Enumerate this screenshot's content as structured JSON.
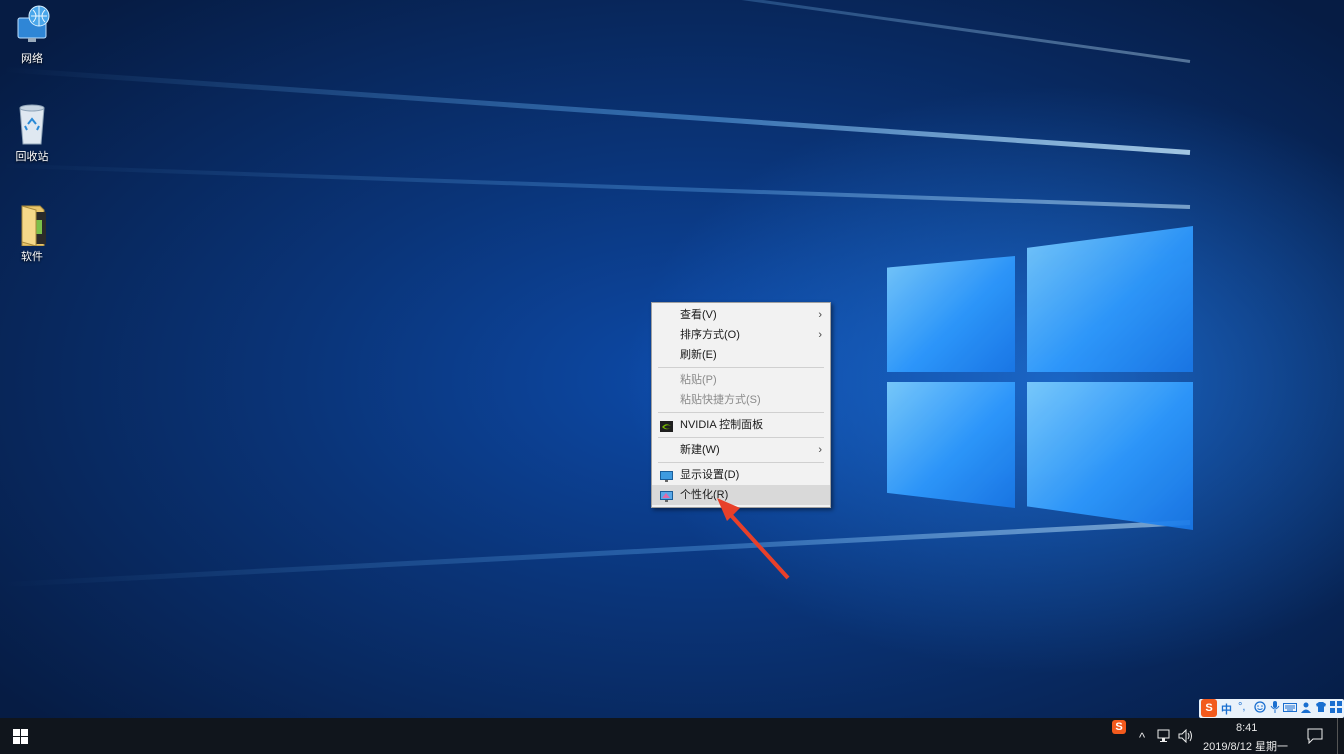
{
  "desktop": {
    "icons": [
      {
        "label": "网络",
        "icon": "network-icon"
      },
      {
        "label": "回收站",
        "icon": "recycle-bin-icon"
      },
      {
        "label": "软件",
        "icon": "folder-icon"
      }
    ]
  },
  "context_menu": {
    "items": [
      {
        "label": "查看(V)",
        "submenu": true,
        "disabled": false
      },
      {
        "label": "排序方式(O)",
        "submenu": true,
        "disabled": false
      },
      {
        "label": "刷新(E)",
        "submenu": false,
        "disabled": false
      },
      {
        "label": "粘贴(P)",
        "submenu": false,
        "disabled": true
      },
      {
        "label": "粘贴快捷方式(S)",
        "submenu": false,
        "disabled": true
      },
      {
        "label": "NVIDIA 控制面板",
        "submenu": false,
        "disabled": false,
        "icon": "nvidia-icon"
      },
      {
        "label": "新建(W)",
        "submenu": true,
        "disabled": false
      },
      {
        "label": "显示设置(D)",
        "submenu": false,
        "disabled": false,
        "icon": "display-icon"
      },
      {
        "label": "个性化(R)",
        "submenu": false,
        "disabled": false,
        "icon": "personalize-icon",
        "highlighted": true
      }
    ],
    "submenu_glyph": "›"
  },
  "ime_toolbar": {
    "logo": "S",
    "mode": "中",
    "punct": "°,",
    "icons": [
      "emoji-icon",
      "mic-icon",
      "keyboard-icon",
      "user-icon",
      "skin-icon",
      "toolbox-icon"
    ]
  },
  "taskbar": {
    "tray_ime_logo": "S",
    "chevron": "^",
    "time": "8:41",
    "date": "2019/8/12 星期一"
  },
  "colors": {
    "accent_arrow": "#e8402a",
    "taskbar_bg": "#10151c",
    "menu_bg": "#f2f2f2"
  }
}
